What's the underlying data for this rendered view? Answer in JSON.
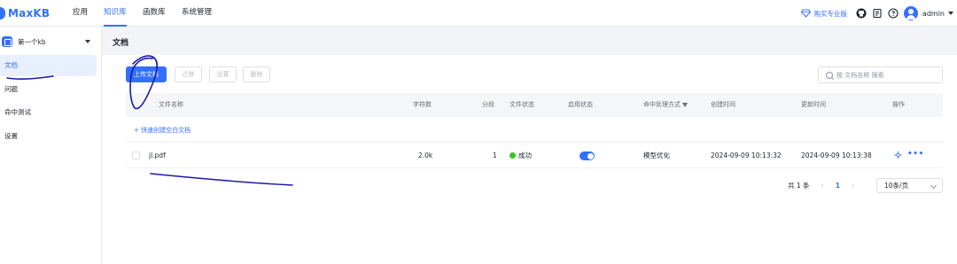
{
  "app": {
    "logo_text": "MaxKB"
  },
  "nav": [
    {
      "label": "应用"
    },
    {
      "label": "知识库"
    },
    {
      "label": "函数库"
    },
    {
      "label": "系统管理"
    }
  ],
  "header": {
    "buy_label": "购买专业版",
    "user_name": "admin"
  },
  "sidebar": {
    "kb_name": "第一个kb",
    "items": [
      {
        "label": "文档"
      },
      {
        "label": "问题"
      },
      {
        "label": "命中测试"
      },
      {
        "label": "设置"
      }
    ]
  },
  "main": {
    "title": "文档",
    "toolbar": {
      "upload_label": "上传文档",
      "migrate_label": "迁移",
      "settings_label": "设置",
      "delete_label": "删除"
    },
    "search": {
      "placeholder": "按 文档名称 搜索"
    },
    "table": {
      "columns": [
        "文件名称",
        "字符数",
        "分段",
        "文件状态",
        "启用状态",
        "命中处理方式",
        "创建时间",
        "更新时间",
        "操作"
      ],
      "quick_create_label": "+ 快速创建空白文档",
      "rows": [
        {
          "name": "jl.pdf",
          "chars": "2.0k",
          "segments": "1",
          "status": "成功",
          "enabled": true,
          "hit_handling": "模型优化",
          "created": "2024-09-09 10:13:32",
          "updated": "2024-09-09 10:13:38"
        }
      ]
    },
    "pagination": {
      "total_label": "共 1 条",
      "prev": "‹",
      "current_page": "1",
      "next": "›",
      "page_size": "10条/页"
    }
  },
  "colors": {
    "accent": "#3370ff",
    "success": "#34c724",
    "ink_annotation": "#1a1aa6"
  }
}
